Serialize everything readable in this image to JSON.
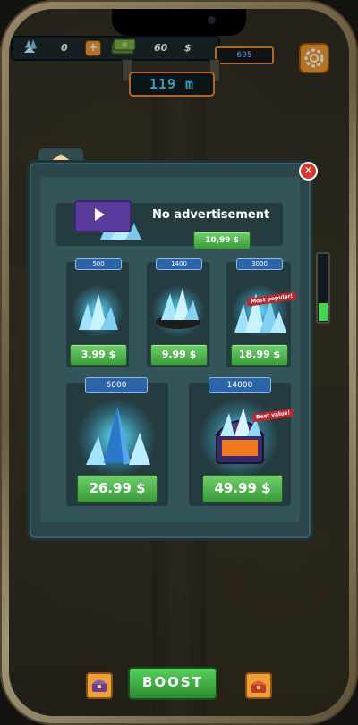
{
  "hud": {
    "gems": "0",
    "cash": "60",
    "cash_suffix": "$",
    "energy": "695",
    "depth": "119 m"
  },
  "shop": {
    "close_label": "✕",
    "no_ads": {
      "title": "No advertisement",
      "price": "10,99 $"
    },
    "small_packs": [
      {
        "qty": "500",
        "price": "3.99 $",
        "ribbon": ""
      },
      {
        "qty": "1400",
        "price": "9.99 $",
        "ribbon": ""
      },
      {
        "qty": "3000",
        "price": "18.99 $",
        "ribbon": "Most popular!"
      }
    ],
    "large_packs": [
      {
        "qty": "6000",
        "price": "26.99 $",
        "ribbon": ""
      },
      {
        "qty": "14000",
        "price": "49.99 $",
        "ribbon": "Best value!"
      }
    ]
  },
  "bottom": {
    "boost_label": "BOOST"
  },
  "icons": [
    "gem-icon",
    "cash-icon",
    "plus-icon",
    "gear-icon",
    "bank-icon",
    "video-play-icon",
    "close-icon",
    "chest-icon",
    "pickaxe-icon"
  ],
  "colors": {
    "accent_orange": "#f08a2a",
    "buy_green": "#4cb548",
    "panel_teal": "#2b474b",
    "depth_cyan": "#47d6ff"
  }
}
